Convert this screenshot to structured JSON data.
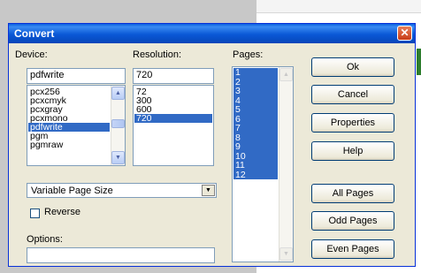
{
  "dialog": {
    "title": "Convert",
    "close_icon": "close-icon"
  },
  "device": {
    "label": "Device:",
    "value": "pdfwrite",
    "items": [
      "pcx256",
      "pcxcmyk",
      "pcxgray",
      "pcxmono",
      "pdfwrite",
      "pgm",
      "pgmraw"
    ],
    "selected": "pdfwrite"
  },
  "resolution": {
    "label": "Resolution:",
    "value": "720",
    "items": [
      "72",
      "300",
      "600",
      "720"
    ],
    "selected": "720"
  },
  "pages": {
    "label": "Pages:",
    "items": [
      "1",
      "2",
      "3",
      "4",
      "5",
      "6",
      "7",
      "8",
      "9",
      "10",
      "11",
      "12"
    ],
    "all_selected": true
  },
  "page_size": {
    "value": "Variable Page Size"
  },
  "reverse": {
    "label": "Reverse",
    "checked": false
  },
  "options": {
    "label": "Options:",
    "value": ""
  },
  "buttons": {
    "ok": "Ok",
    "cancel": "Cancel",
    "properties": "Properties",
    "help": "Help",
    "all_pages": "All Pages",
    "odd_pages": "Odd Pages",
    "even_pages": "Even Pages"
  },
  "colors": {
    "title_bar": "#0a58d6",
    "selection": "#316ac5",
    "dialog_bg": "#ece9d8"
  }
}
